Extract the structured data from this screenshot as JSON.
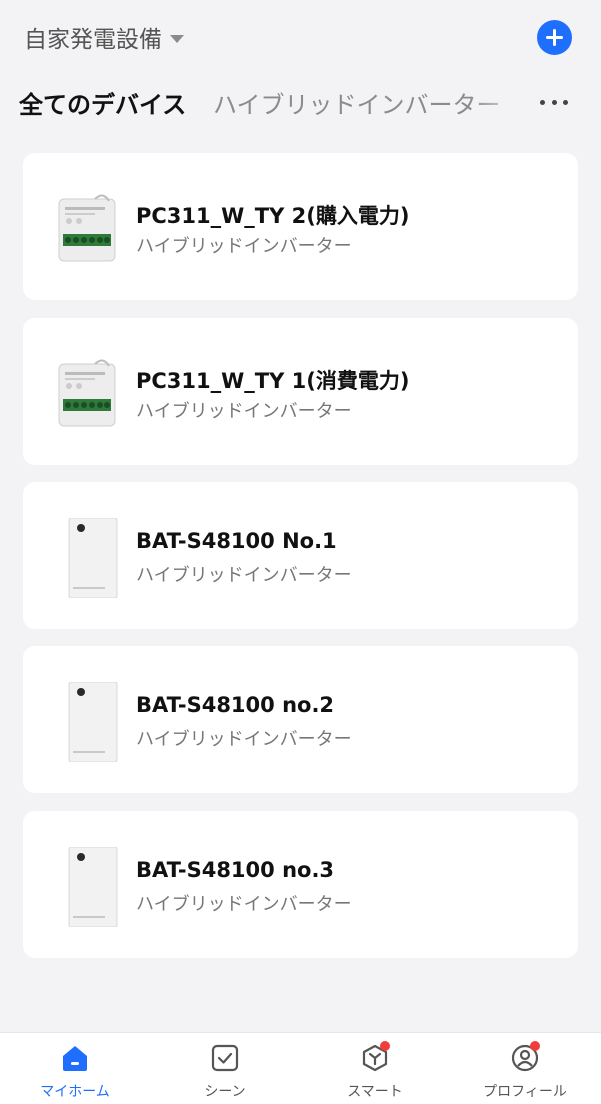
{
  "header": {
    "home_name": "自家発電設備",
    "add_icon": "plus-icon",
    "accent_color": "#1f6fff"
  },
  "tabs": {
    "active": "全てのデバイス",
    "inactive": "ハイブリッドインバーター",
    "more_icon": "more-icon"
  },
  "devices": [
    {
      "name": "PC311_W_TY 2(購入電力)",
      "room": "ハイブリッドインバーター",
      "type": "power-meter"
    },
    {
      "name": "PC311_W_TY 1(消費電力)",
      "room": "ハイブリッドインバーター",
      "type": "power-meter"
    },
    {
      "name": "BAT-S48100 No.1",
      "room": "ハイブリッドインバーター",
      "type": "battery"
    },
    {
      "name": "BAT-S48100 no.2",
      "room": "ハイブリッドインバーター",
      "type": "battery"
    },
    {
      "name": "BAT-S48100 no.3",
      "room": "ハイブリッドインバーター",
      "type": "battery"
    }
  ],
  "nav": [
    {
      "label": "マイホーム",
      "icon": "home-icon",
      "active": true,
      "badge": false
    },
    {
      "label": "シーン",
      "icon": "scene-check-icon",
      "active": false,
      "badge": false
    },
    {
      "label": "スマート",
      "icon": "smart-cube-icon",
      "active": false,
      "badge": true
    },
    {
      "label": "プロフィール",
      "icon": "profile-icon",
      "active": false,
      "badge": true
    }
  ],
  "badge_color": "#f23c3c"
}
